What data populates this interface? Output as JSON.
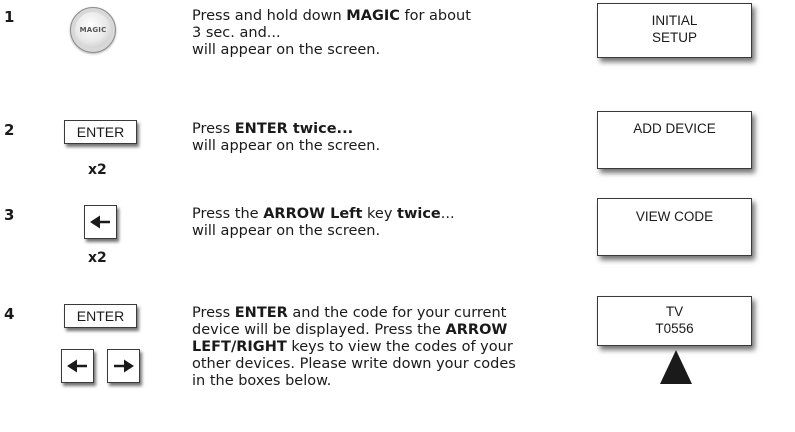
{
  "steps": [
    {
      "num": "1",
      "button": "MAGIC",
      "text": [
        {
          "t": "Press and hold down ",
          "b": false
        },
        {
          "t": "MAGIC",
          "b": true
        },
        {
          "t": " for about",
          "b": false
        },
        {
          "t": "\n3 sec. and...",
          "b": false
        },
        {
          "t": "\nwill appear on the screen.",
          "b": false
        }
      ],
      "screen": [
        "INITIAL",
        "SETUP"
      ]
    },
    {
      "num": "2",
      "button": "ENTER",
      "times": "x2",
      "text": [
        {
          "t": "Press ",
          "b": false
        },
        {
          "t": "ENTER twice...",
          "b": true
        },
        {
          "t": "\nwill appear on the screen.",
          "b": false
        }
      ],
      "screen": [
        "ADD DEVICE"
      ]
    },
    {
      "num": "3",
      "button": "arrow-left-icon",
      "times": "x2",
      "text": [
        {
          "t": "Press the ",
          "b": false
        },
        {
          "t": "ARROW Left",
          "b": true
        },
        {
          "t": " key ",
          "b": false
        },
        {
          "t": "twice",
          "b": true
        },
        {
          "t": "...",
          "b": false
        },
        {
          "t": "\nwill appear on the screen.",
          "b": false
        }
      ],
      "screen": [
        "VIEW CODE"
      ]
    },
    {
      "num": "4",
      "button": "ENTER",
      "text": [
        {
          "t": "Press ",
          "b": false
        },
        {
          "t": "ENTER",
          "b": true
        },
        {
          "t": " and the code for your current",
          "b": false
        },
        {
          "t": "\ndevice will be displayed. Press the ",
          "b": false
        },
        {
          "t": "ARROW",
          "b": true
        },
        {
          "t": "\nLEFT/RIGHT",
          "b": true
        },
        {
          "t": " keys to view the codes of your",
          "b": false
        },
        {
          "t": "\nother devices. Please write down your codes",
          "b": false
        },
        {
          "t": "\nin the boxes below.",
          "b": false
        }
      ],
      "screen": [
        "TV",
        "T0556"
      ]
    }
  ]
}
